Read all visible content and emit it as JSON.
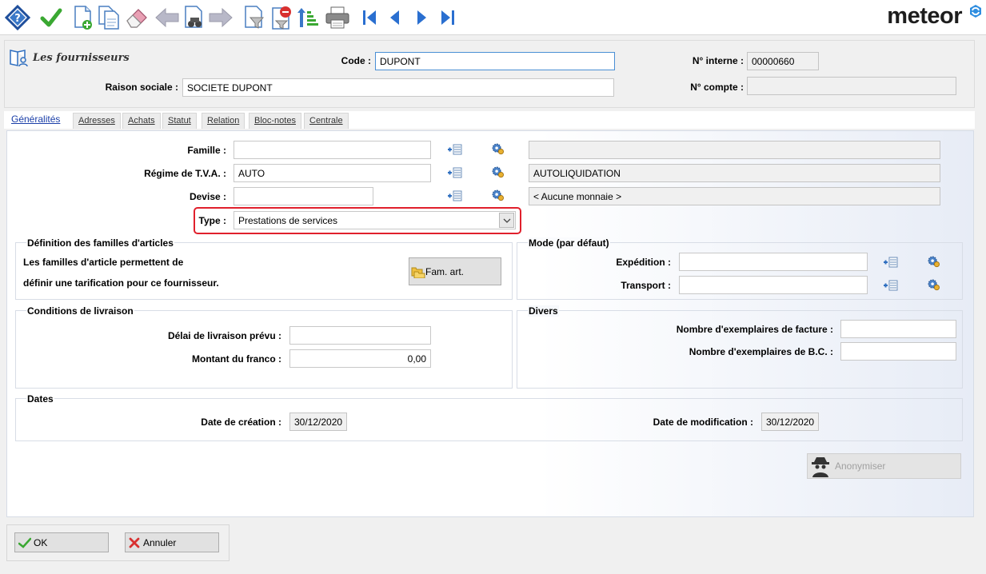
{
  "brand": {
    "logo_text": "meteor"
  },
  "toolbar": {
    "icons": [
      "help-icon",
      "validate-check-icon",
      "new-document-icon",
      "duplicate-document-icon",
      "eraser-icon",
      "previous-arrow-icon",
      "search-binoculars-icon",
      "next-arrow-icon",
      "filter-document-icon",
      "delete-filter-icon",
      "sort-icon",
      "print-icon",
      "first-record-icon",
      "previous-record-icon",
      "next-record-icon",
      "last-record-icon"
    ]
  },
  "header": {
    "module_title": "Les fournisseurs",
    "code_label": "Code :",
    "code_value": "DUPONT",
    "raison_sociale_label": "Raison sociale :",
    "raison_sociale_value": "SOCIETE DUPONT",
    "num_interne_label": "N° interne :",
    "num_interne_value": "00000660",
    "num_compte_label": "N° compte :",
    "num_compte_value": ""
  },
  "tabs": [
    {
      "label": "Généralités",
      "active": true
    },
    {
      "label": "Adresses"
    },
    {
      "label": "Achats"
    },
    {
      "label": "Statut"
    },
    {
      "label": "Relation"
    },
    {
      "label": "Bloc-notes"
    },
    {
      "label": "Centrale"
    }
  ],
  "general": {
    "famille_label": "Famille :",
    "famille_value": "",
    "famille_desc": "",
    "tva_label": "Régime de T.V.A. :",
    "tva_value": "AUTO",
    "tva_desc": "AUTOLIQUIDATION",
    "devise_label": "Devise :",
    "devise_value": "",
    "devise_desc": "< Aucune monnaie >",
    "type_label": "Type :",
    "type_value": "Prestations de services"
  },
  "familles": {
    "title": "Définition des familles d'articles",
    "line1": "Les familles d'article permettent de",
    "line2": "définir une tarification pour ce fournisseur.",
    "button_label": "Fam. art."
  },
  "mode": {
    "title": "Mode (par défaut)",
    "expedition_label": "Expédition :",
    "expedition_value": "",
    "transport_label": "Transport :",
    "transport_value": ""
  },
  "livraison": {
    "title": "Conditions de livraison",
    "delai_label": "Délai de livraison prévu :",
    "delai_value": "",
    "franco_label": "Montant du franco :",
    "franco_value": "0,00"
  },
  "divers": {
    "title": "Divers",
    "facture_label": "Nombre d'exemplaires de facture :",
    "facture_value": "",
    "bc_label": "Nombre d'exemplaires de B.C. :",
    "bc_value": ""
  },
  "dates": {
    "title": "Dates",
    "creation_label": "Date de création :",
    "creation_value": "30/12/2020",
    "modification_label": "Date de modification :",
    "modification_value": "30/12/2020"
  },
  "anonymiser": {
    "label": "Anonymiser"
  },
  "footer": {
    "ok_label": "OK",
    "annuler_label": "Annuler"
  },
  "colors": {
    "accent": "#1f6fc4",
    "highlight_outline": "#e0202c",
    "check_green": "#3aa832"
  }
}
